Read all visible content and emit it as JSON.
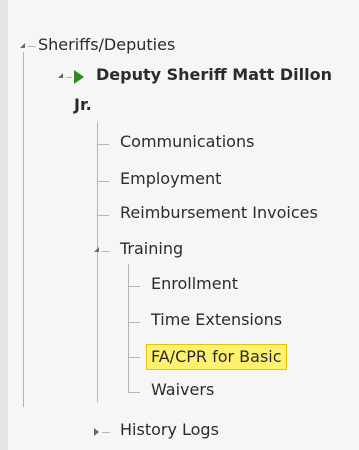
{
  "tree": {
    "root": {
      "label": "Sheriffs/Deputies",
      "expanded": true
    },
    "deputy": {
      "label_line1": "Deputy Sheriff Matt Dillon",
      "label_line2": "Jr.",
      "expanded": true,
      "status_icon": "play-arrow-icon"
    },
    "children": [
      {
        "label": "Communications"
      },
      {
        "label": "Employment"
      },
      {
        "label": "Reimbursement Invoices"
      },
      {
        "label": "Training",
        "expanded": true
      },
      {
        "label": "History Logs",
        "expanded": false
      }
    ],
    "training_children": [
      {
        "label": "Enrollment"
      },
      {
        "label": "Time Extensions"
      },
      {
        "label": "FA/CPR for Basic",
        "selected": true
      },
      {
        "label": "Waivers"
      }
    ]
  },
  "colors": {
    "selected_background": "#fff170",
    "selected_border": "#e6c200",
    "status_icon": "#2e8b1e"
  }
}
